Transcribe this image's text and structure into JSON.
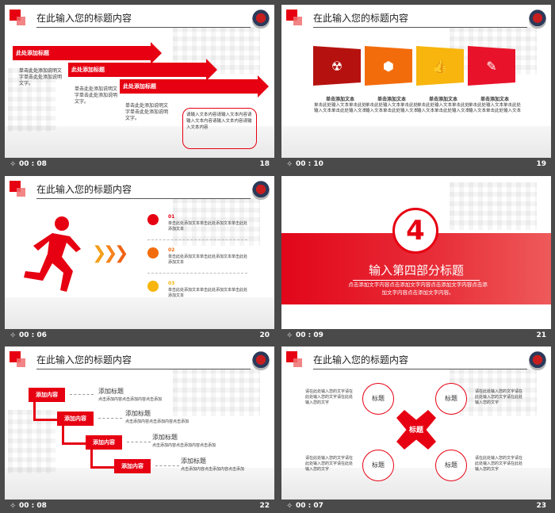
{
  "slides": [
    {
      "title": "在此输入您的标题内容",
      "time": "00 : 08",
      "number": "18",
      "arrows": [
        "此处添加标题",
        "此处添加标题",
        "此处添加标题"
      ],
      "descs": [
        "单击此处添加说明文字单击此处添加说明文字。",
        "单击此处添加说明文字单击此处添加说明文字。",
        "单击此处添加说明文字单击此处添加说明文字。"
      ],
      "note": "请输入文本内容请输入文本内容请输入文本内容请输入文本内容请输入文本内容"
    },
    {
      "title": "在此输入您的标题内容",
      "time": "00 : 10",
      "number": "19",
      "cards": [
        {
          "caption": "单击添加文本",
          "text": "单击此处输入文本单击此处输入文本单击此处输入文本",
          "color": "#b5120f",
          "icon": "radiation-icon"
        },
        {
          "caption": "单击添加文本",
          "text": "单击此处输入文本单击此处输入文本单击此处输入文本",
          "color": "#f36c0c",
          "icon": "box-icon"
        },
        {
          "caption": "单击添加文本",
          "text": "单击此处输入文本单击此处输入文本单击此处输入文本",
          "color": "#f7b50d",
          "icon": "thumbs-up-icon"
        },
        {
          "caption": "单击添加文本",
          "text": "单击此处输入文本单击此处输入文本单击此处输入文本",
          "color": "#e8132a",
          "icon": "pencil-icon"
        }
      ]
    },
    {
      "title": "在此输入您的标题内容",
      "time": "00 : 06",
      "number": "20",
      "items": [
        {
          "num": "01",
          "text": "单击此处添加文本单击此处添加文本单击此处添加文本"
        },
        {
          "num": "02",
          "text": "单击此处添加文本单击此处添加文本单击此处添加文本"
        },
        {
          "num": "03",
          "text": "单击此处添加文本单击此处添加文本单击此处添加文本"
        }
      ]
    },
    {
      "time": "00 : 09",
      "number": "21",
      "big_number": "4",
      "section_title": "输入第四部分标题",
      "section_text": "点击添加文字内容点击添加文字内容点击添加文字内容点击添加文字内容点击添加文字内容。"
    },
    {
      "title": "在此输入您的标题内容",
      "time": "00 : 08",
      "number": "22",
      "steps": [
        {
          "btn": "添加内容",
          "head": "添加标题",
          "text": "点击添加内容点击添加内容点击添加"
        },
        {
          "btn": "添加内容",
          "head": "添加标题",
          "text": "点击添加内容点击添加内容点击添加"
        },
        {
          "btn": "添加内容",
          "head": "添加标题",
          "text": "点击添加内容点击添加内容点击添加"
        },
        {
          "btn": "添加内容",
          "head": "添加标题",
          "text": "点击添加内容点击添加内容点击添加"
        }
      ]
    },
    {
      "title": "在此输入您的标题内容",
      "time": "00 : 07",
      "number": "23",
      "center": "标题",
      "rings": [
        "标题",
        "标题",
        "标题",
        "标题"
      ],
      "side_text": "请在此处输入您的文字请在此处输入您的文字请在此处输入您的文字"
    }
  ]
}
